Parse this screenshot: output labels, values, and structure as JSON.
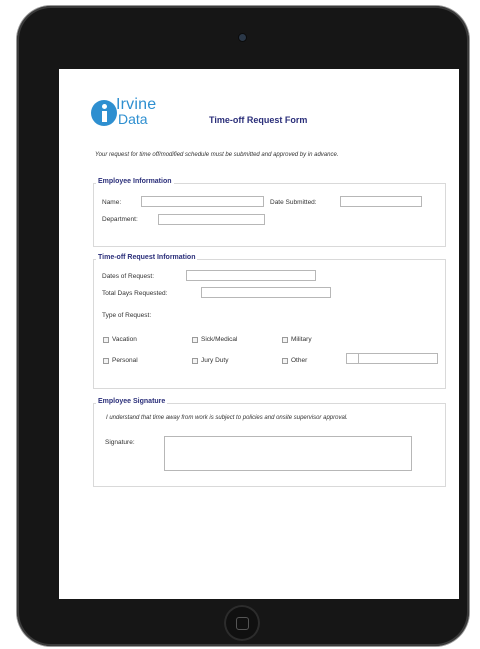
{
  "logo": {
    "line1": "Irvine",
    "line2": "Data"
  },
  "form_title": "Time-off Request Form",
  "intro": "Your request for time off/modified schedule must be submitted and approved by in advance.",
  "employee_info": {
    "title": "Employee Information",
    "name_label": "Name:",
    "date_submitted_label": "Date Submitted:",
    "department_label": "Department:"
  },
  "request_info": {
    "title": "Time-off Request Information",
    "dates_label": "Dates of Request:",
    "total_days_label": "Total Days Requested:",
    "type_label": "Type of Request:",
    "types": {
      "vacation": "Vacation",
      "sick_medical": "Sick/Medical",
      "military": "Military",
      "personal": "Personal",
      "jury_duty": "Jury Duty",
      "other": "Other"
    }
  },
  "signature": {
    "title": "Employee Signature",
    "note": "I understand that time away from work is subject to policies and onsite supervisor approval.",
    "label": "Signature:"
  }
}
